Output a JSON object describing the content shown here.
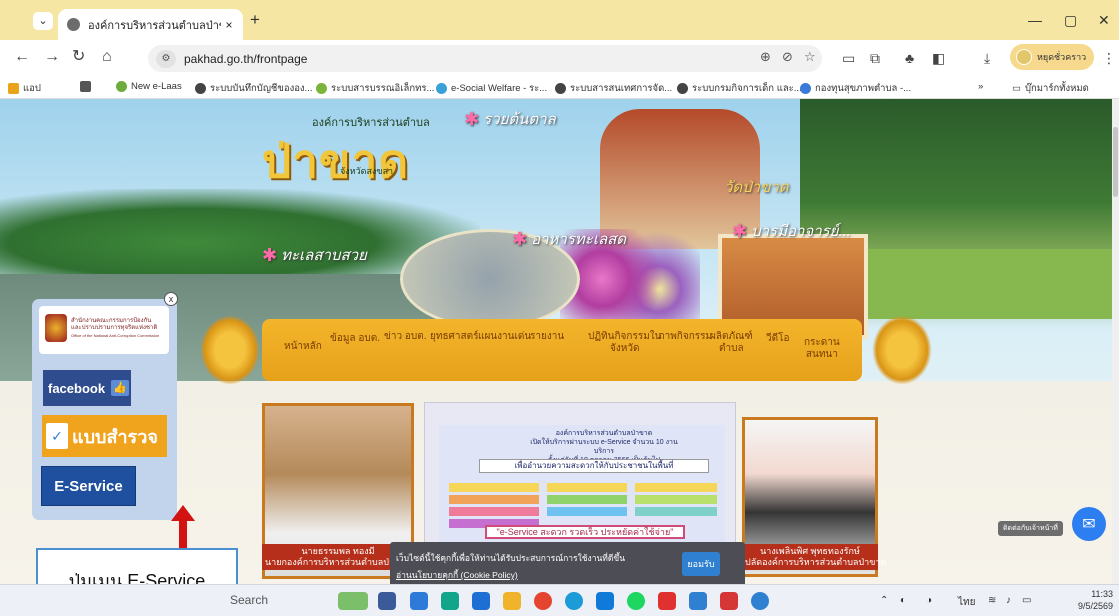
{
  "browser": {
    "tab_title": "องค์การบริหารส่วนตำบลป่าขาด อ.สิง",
    "tab_close": "×",
    "new_tab": "+",
    "url": "pakhad.go.th/frontpage",
    "profile_name": "หยุดชั่วคราว",
    "bookmarks": [
      {
        "label": "แอป",
        "color": "#e8a31a"
      },
      {
        "label": "",
        "color": "#555"
      },
      {
        "label": "New e-Laas",
        "color": "#6cac3c"
      },
      {
        "label": "ระบบบันทึกบัญชีขององ...",
        "color": "#444"
      },
      {
        "label": "ระบบสารบรรณอิเล็กทร...",
        "color": "#7ab43a"
      },
      {
        "label": "e-Social Welfare - ระ...",
        "color": "#3aa0d8"
      },
      {
        "label": "ระบบสารสนเทศการจัด...",
        "color": "#444"
      },
      {
        "label": "ระบบกรมกิจการเด็ก และ...",
        "color": "#444"
      },
      {
        "label": "กองทุนสุขภาพตำบล -...",
        "color": "#3a7ad8"
      }
    ],
    "bookmarks_more": "»",
    "all_bookmarks": "บุ๊กมาร์กทั้งหมด"
  },
  "header": {
    "org_small": "องค์การบริหารส่วนตำบล",
    "org_big": "ป่าขาด",
    "province": "จังหวัดสงขลา",
    "captions": {
      "salt": "รวยต้นตาล",
      "temple": "วัดป่าขาด",
      "seafood": "อาหารทะเลสด",
      "lake": "ทะเลสาบสวย",
      "merit": "บารมีอาจารย์..."
    }
  },
  "nav": {
    "items": [
      {
        "label": "หน้าหลัก",
        "label2": ""
      },
      {
        "label": "ข้อมูล อบต.",
        "label2": ""
      },
      {
        "label": "ข่าว อบต.",
        "label2": ""
      },
      {
        "label": "ยุทธศาสตร์",
        "label2": ""
      },
      {
        "label": "แผนงานเด่น",
        "label2": ""
      },
      {
        "label": "รายงาน",
        "label2": ""
      },
      {
        "label": "ปฏิทินกิจกรรมใน",
        "label2": "จังหวัด"
      },
      {
        "label": "ภาพกิจกรรม",
        "label2": ""
      },
      {
        "label": "ผลิตภัณฑ์",
        "label2": "ตำบล"
      },
      {
        "label": "วีดีโอ",
        "label2": ""
      },
      {
        "label": "กระดาน",
        "label2": "สนทนา"
      }
    ]
  },
  "content": {
    "left_name": "นายธรรมพล ทองมี",
    "left_title": "นายกองค์การบริหารส่วนตำบลป่าขาด",
    "right_name": "นางเพลินพิศ พุทธทองรักษ์",
    "right_title": "ปลัดองค์การบริหารส่วนตำบลป่าขาด",
    "poster_title_1": "องค์การบริหารส่วนตำบลป่าขาด",
    "poster_title_2": "เปิดให้บริการผ่านระบบ e-Service จำนวน 10 งานบริการ",
    "poster_title_3": "ตั้งแต่วันที่ 18 ตุลาคม 2566 เป็นต้นไป",
    "poster_banner": "เพื่ออำนวยความสะดวกให้กับประชาชนในพื้นที่",
    "poster_slogan": "\"e-Service สะดวก รวดเร็ว ประหยัดค่าใช้จ่าย\""
  },
  "cookie": {
    "text": "เว็บไซต์นี้ใช้คุกกี้เพื่อให้ท่านได้รับประสบการณ์การใช้งานที่ดีขึ้น",
    "link": "อ่านนโยบายคุกกี้ (Cookie Policy)",
    "accept": "ยอมรับ"
  },
  "sidepanel": {
    "close": "x",
    "org_line1": "สำนักงานคณะกรรมการป้องกัน",
    "org_line2": "และปราบปรามการทุจริตแห่งชาติ",
    "org_line3": "Office of the National Anti-Corruption Commission",
    "facebook": "facebook",
    "survey": "แบบสำรวจ",
    "eservice": "E-Service"
  },
  "contact_button": "ติดต่อกับเจ้าหน้าที่",
  "annotation": "ปุ่มเมนู E-Service",
  "taskbar": {
    "search": "Search",
    "lang": "ไทย",
    "time": "11:33",
    "date": "9/5/2569",
    "apps": [
      "#7bbf6a",
      "#3b5a9a",
      "#2e7ad8",
      "#12a58a",
      "#1d6fd3",
      "#1e90ff",
      "#e5452f",
      "#1d9bd8",
      "#0f7ad8",
      "#1ed760",
      "#e03030",
      "#2f80d0",
      "#d53636",
      "#2f80d0"
    ]
  }
}
